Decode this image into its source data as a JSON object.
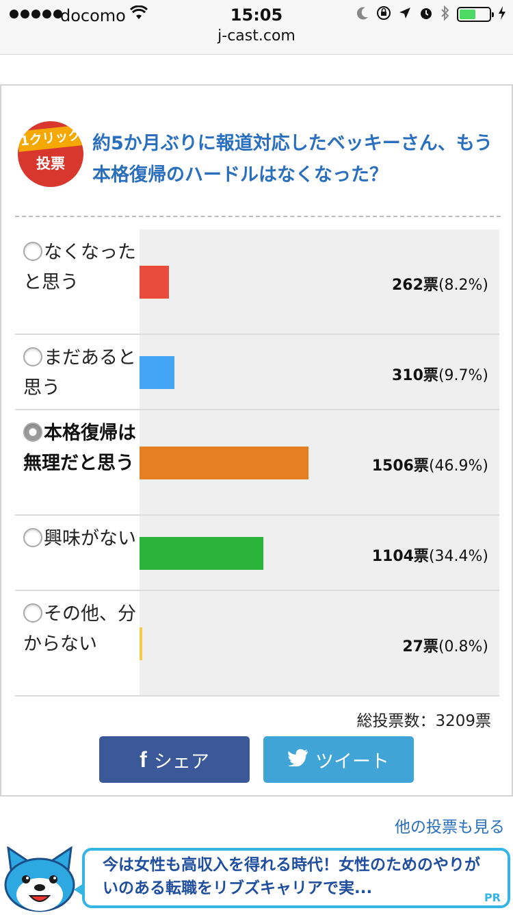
{
  "status_bar": {
    "carrier": "docomo",
    "time": "15:05",
    "url": "j-cast.com",
    "battery_level": 0.55
  },
  "poll": {
    "badge_top": "1クリック",
    "badge_bottom": "投票",
    "question": "約5か月ぶりに報道対応したベッキーさん、もう本格復帰のハードルはなくなった？",
    "options": [
      {
        "label": "なくなったと思う",
        "count": "262票",
        "pct": "(8.2%)",
        "share": 0.082,
        "color": "#e94c3d",
        "selected": false
      },
      {
        "label": "まだあると思う",
        "count": "310票",
        "pct": "(9.7%)",
        "share": 0.097,
        "color": "#42a5f5",
        "selected": false
      },
      {
        "label": "本格復帰は無理だと思う",
        "count": "1506票",
        "pct": "(46.9%)",
        "share": 0.469,
        "color": "#e67e22",
        "selected": true
      },
      {
        "label": "興味がない",
        "count": "1104票",
        "pct": "(34.4%)",
        "share": 0.344,
        "color": "#2ab53a",
        "selected": false
      },
      {
        "label": "その他、分からない",
        "count": "27票",
        "pct": "(0.8%)",
        "share": 0.008,
        "color": "#f7c948",
        "selected": false
      }
    ],
    "total": "総投票数：3209票",
    "share_button": "シェア",
    "tweet_button": "ツイート",
    "more_link": "他の投票も見る"
  },
  "ad": {
    "text": "今は女性も高収入を得れる時代！女性のためのやりがいのある転職をリブズキャリアで実...",
    "label": "PR"
  }
}
